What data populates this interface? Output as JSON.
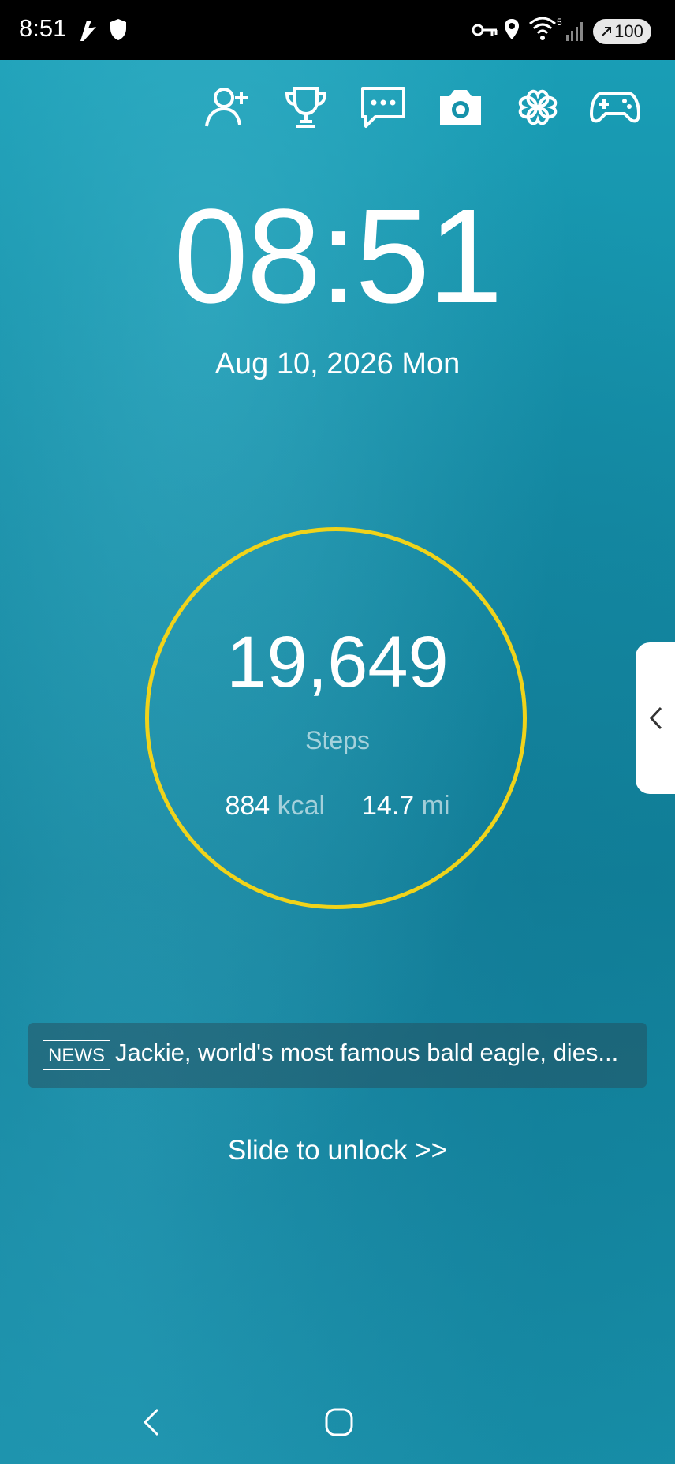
{
  "status_bar": {
    "time": "8:51",
    "battery_level": "100",
    "icons": [
      "notification-app-icon",
      "shield-icon",
      "key-icon",
      "location-icon",
      "wifi-icon",
      "signal-icon",
      "battery-icon"
    ]
  },
  "shortcuts": [
    {
      "icon": "add-user-icon"
    },
    {
      "icon": "trophy-icon"
    },
    {
      "icon": "chat-icon"
    },
    {
      "icon": "camera-icon"
    },
    {
      "icon": "clover-icon"
    },
    {
      "icon": "gamepad-icon"
    }
  ],
  "clock": {
    "time": "08:51",
    "date": "Aug 10, 2026 Mon"
  },
  "steps": {
    "count": "19,649",
    "label": "Steps",
    "kcal_value": "884",
    "kcal_unit": "kcal",
    "distance_value": "14.7",
    "distance_unit": "mi",
    "ring_color": "#f0d31a"
  },
  "news": {
    "tag": "NEWS",
    "headline": "Jackie, world's most famous bald eagle, dies..."
  },
  "slide_to_unlock": "Slide to unlock >>",
  "wallpaper": {
    "colors": [
      "#1aa0b8",
      "#0f7f97"
    ]
  }
}
